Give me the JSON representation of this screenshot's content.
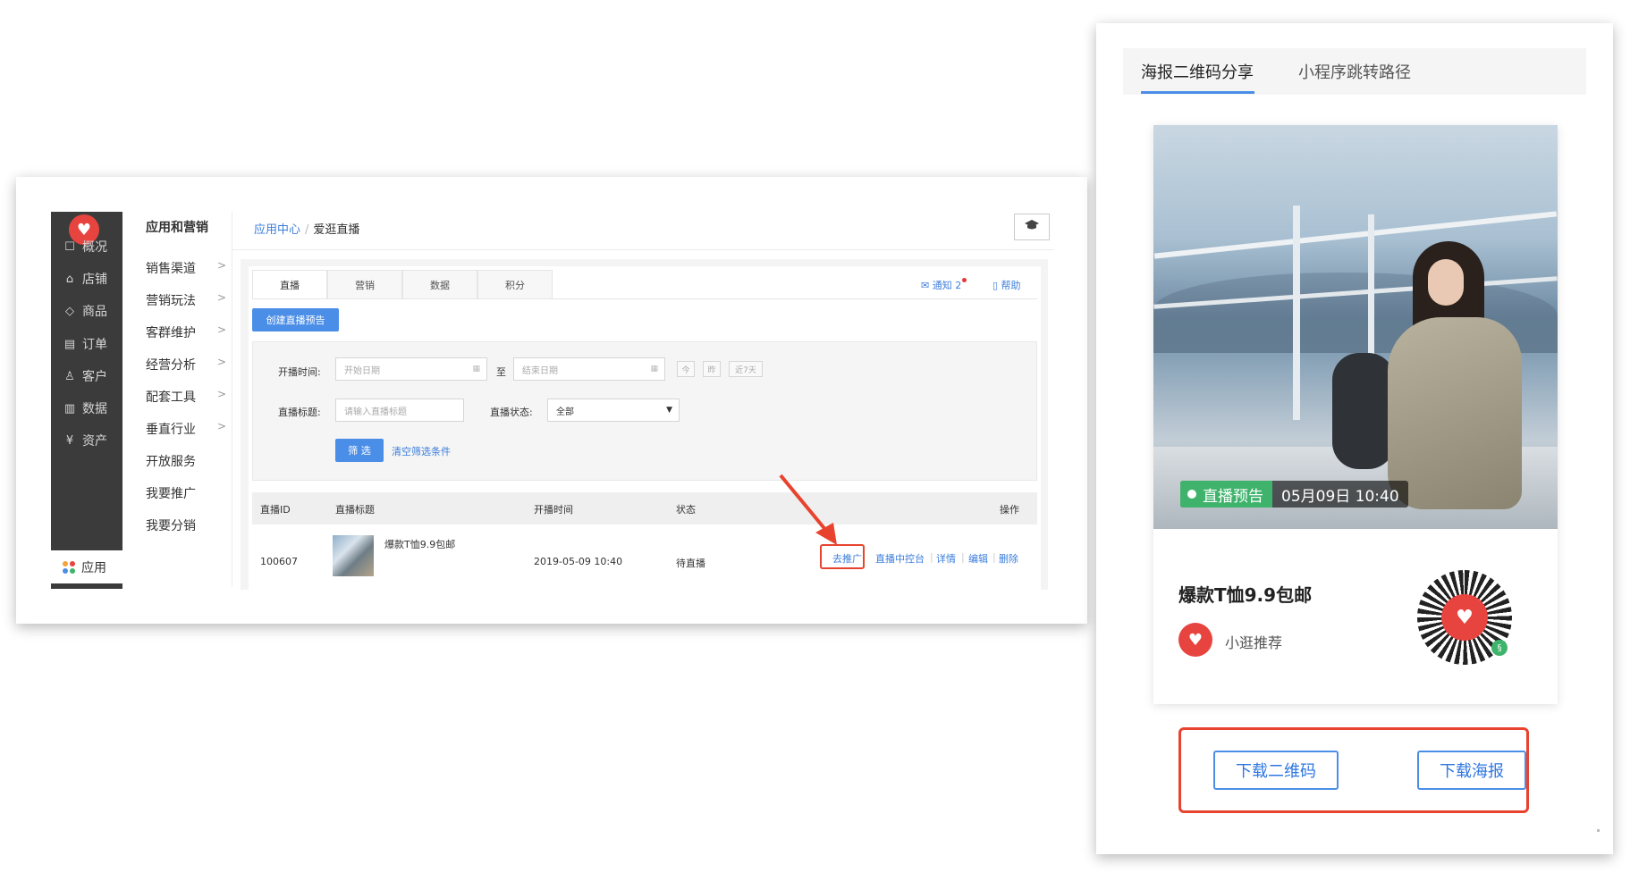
{
  "left": {
    "logo_glyph": "♥",
    "nav": [
      {
        "icon": "☐",
        "label": "概况"
      },
      {
        "icon": "⌂",
        "label": "店铺"
      },
      {
        "icon": "◇",
        "label": "商品"
      },
      {
        "icon": "▤",
        "label": "订单"
      },
      {
        "icon": "♙",
        "label": "客户"
      },
      {
        "icon": "▥",
        "label": "数据"
      },
      {
        "icon": "¥",
        "label": "资产"
      }
    ],
    "apps_label": "应用",
    "sub_title": "应用和营销",
    "sub_items": [
      {
        "label": "销售渠道",
        "chevron": ">"
      },
      {
        "label": "营销玩法",
        "chevron": ">"
      },
      {
        "label": "客群维护",
        "chevron": ">"
      },
      {
        "label": "经营分析",
        "chevron": ">"
      },
      {
        "label": "配套工具",
        "chevron": ">"
      },
      {
        "label": "垂直行业",
        "chevron": ">"
      },
      {
        "label": "开放服务",
        "chevron": ""
      },
      {
        "label": "我要推广",
        "chevron": ""
      },
      {
        "label": "我要分销",
        "chevron": ""
      }
    ],
    "breadcrumb": {
      "parent": "应用中心",
      "sep": "/",
      "current": "爱逛直播"
    },
    "tabs": [
      "直播",
      "营销",
      "数据",
      "积分"
    ],
    "notify": "✉ 通知 2",
    "help": "▯ 帮助",
    "create_btn": "创建直播预告",
    "filter": {
      "time_label": "开播时间:",
      "start_placeholder": "开始日期",
      "to": "至",
      "end_placeholder": "结束日期",
      "quick": [
        "今",
        "昨",
        "近7天"
      ],
      "title_label": "直播标题:",
      "title_placeholder": "请输入直播标题",
      "status_label": "直播状态:",
      "status_value": "全部",
      "submit": "筛 选",
      "clear": "清空筛选条件"
    },
    "table": {
      "headers": [
        "直播ID",
        "直播标题",
        "开播时间",
        "状态",
        "操作"
      ],
      "row": {
        "id": "100607",
        "title": "爆款T恤9.9包邮",
        "time": "2019-05-09 10:40",
        "status": "待直播",
        "actions": [
          "去推广",
          "直播中控台",
          "详情",
          "编辑",
          "删除"
        ]
      }
    }
  },
  "right": {
    "tabs": [
      "海报二维码分享",
      "小程序跳转路径"
    ],
    "badge_label": "直播预告",
    "badge_time": "05月09日 10:40",
    "title": "爆款T恤9.9包邮",
    "author": "小逛推荐",
    "avatar_glyph": "♥",
    "download_qr": "下载二维码",
    "download_poster": "下载海报"
  },
  "colors": {
    "accent_blue": "#4b8ee8",
    "highlight_red": "#e8432e",
    "brand_red": "#e7443f",
    "live_green": "#3fb36c"
  }
}
